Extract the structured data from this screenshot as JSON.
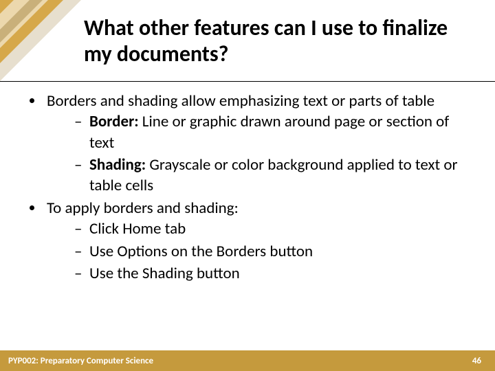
{
  "title": "What other features can I use to finalize my documents?",
  "bullets": {
    "b1": "Borders and shading allow emphasizing text or parts of table",
    "b1a_term": "Border:",
    "b1a_text": " Line or graphic drawn around page or section of text",
    "b1b_term": "Shading:",
    "b1b_text": " Grayscale or color background applied to text or table cells",
    "b2": "To apply borders and shading:",
    "b2a": "Click Home tab",
    "b2b": "Use Options on the Borders button",
    "b2c": "Use the Shading button"
  },
  "footer": {
    "course": "PYP002: Preparatory Computer Science",
    "page": "46"
  },
  "colors": {
    "accent": "#c59a3d"
  }
}
